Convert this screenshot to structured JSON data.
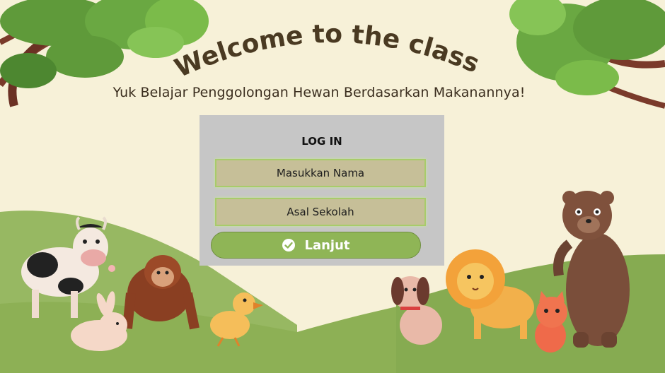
{
  "header": {
    "title": "Welcome to the class!",
    "subtitle": "Yuk Belajar Penggolongan Hewan Berdasarkan Makanannya!"
  },
  "login": {
    "heading": "LOG IN",
    "name_placeholder": "Masukkan Nama",
    "school_placeholder": "Asal Sekolah",
    "submit_label": "Lanjut"
  },
  "colors": {
    "background": "#f7f1d8",
    "panel": "#c6c6c6",
    "field": "#c6bf98",
    "button": "#8fb556",
    "grass": "#8fb25a",
    "title": "#4a3a22"
  },
  "icons": {
    "submit": "check-circle-icon",
    "decor": [
      "tree-branch-icon",
      "cow-icon",
      "orangutan-icon",
      "rabbit-icon",
      "duck-icon",
      "dog-icon",
      "lion-icon",
      "cat-icon",
      "bear-icon"
    ]
  }
}
